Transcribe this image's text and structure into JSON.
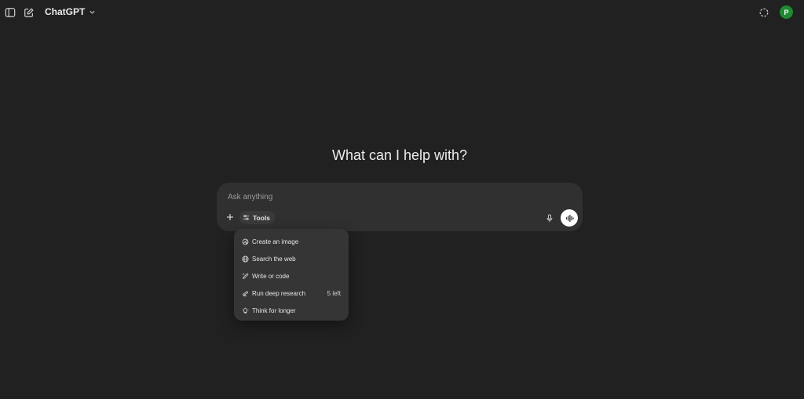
{
  "header": {
    "model_name": "ChatGPT",
    "avatar_initial": "P",
    "avatar_color": "#1e8a32"
  },
  "icons": {
    "sidebar_toggle": "sidebar-toggle-icon",
    "new_chat": "new-chat-icon",
    "model_dropdown": "chevron-down-icon",
    "temporary_chat": "temporary-chat-icon"
  },
  "main": {
    "headline": "What can I help with?"
  },
  "composer": {
    "placeholder": "Ask anything",
    "tools_label": "Tools"
  },
  "tools_menu": {
    "items": [
      {
        "label": "Create an image",
        "icon": "image-icon",
        "badge": ""
      },
      {
        "label": "Search the web",
        "icon": "globe-icon",
        "badge": ""
      },
      {
        "label": "Write or code",
        "icon": "pen-icon",
        "badge": ""
      },
      {
        "label": "Run deep research",
        "icon": "telescope-icon",
        "badge": "5 left"
      },
      {
        "label": "Think for longer",
        "icon": "lightbulb-icon",
        "badge": ""
      }
    ]
  }
}
